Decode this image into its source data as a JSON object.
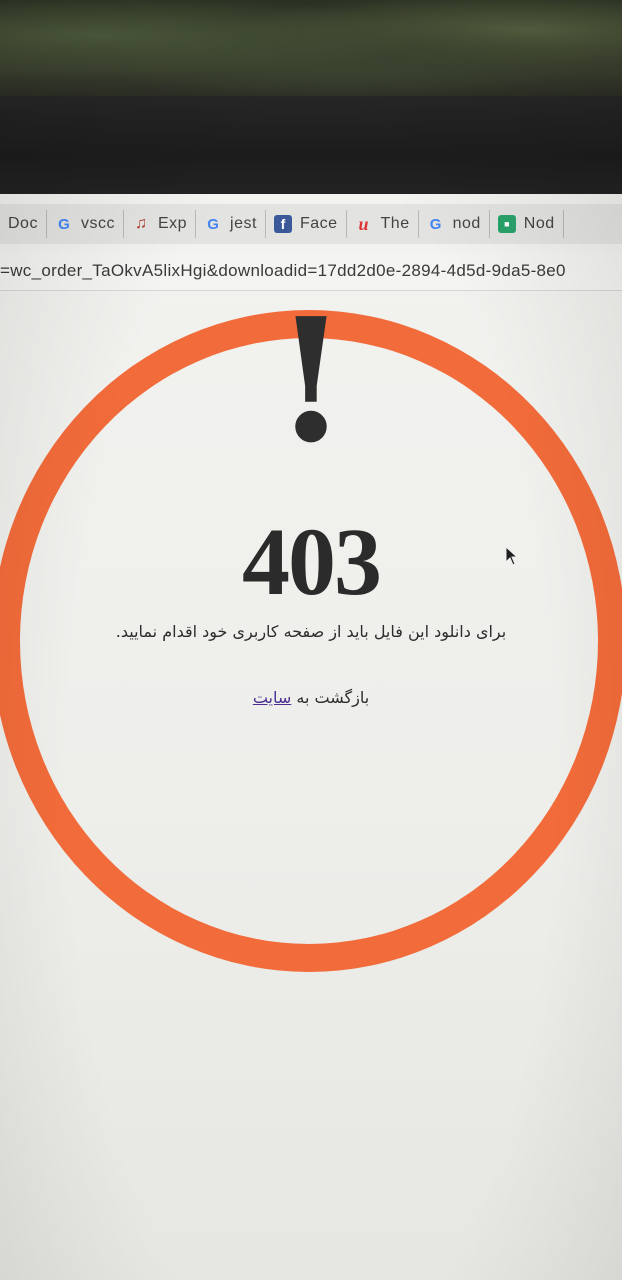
{
  "browser": {
    "tabs": [
      {
        "label": "Doc",
        "icon": "none"
      },
      {
        "label": "vscc",
        "icon": "google-icon"
      },
      {
        "label": "Exp",
        "icon": "music-note-icon"
      },
      {
        "label": "jest",
        "icon": "google-icon"
      },
      {
        "label": "Face",
        "icon": "facebook-icon"
      },
      {
        "label": "The",
        "icon": "red-u-icon"
      },
      {
        "label": "nod",
        "icon": "google-icon"
      },
      {
        "label": "Nod",
        "icon": "green-app-icon"
      }
    ],
    "url": "=wc_order_TaOkvA5lixHgi&downloadid=17dd2d0e-2894-4d5d-9da5-8e0"
  },
  "error": {
    "symbol": "!",
    "code": "403",
    "message": "برای دانلود این فایل باید از صفحه کاربری خود اقدام نمایید.",
    "back_prefix": "بازگشت به ",
    "back_link": "سایت"
  },
  "colors": {
    "ring": "#f26b3a",
    "text": "#2d2d2d",
    "link": "#4b2f93"
  }
}
